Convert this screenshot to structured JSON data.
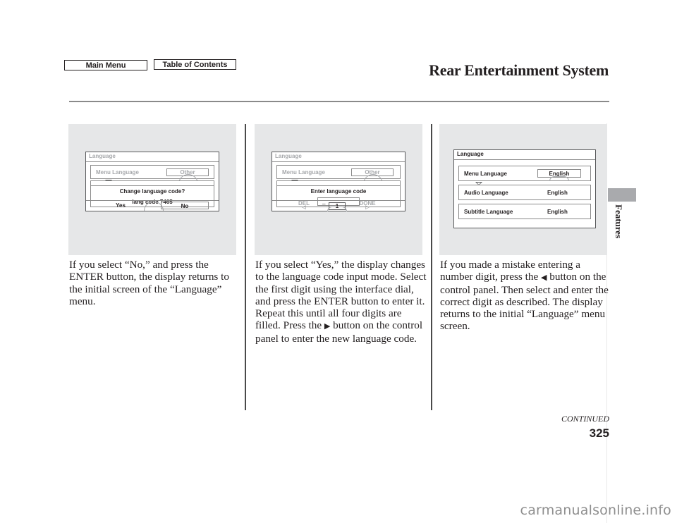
{
  "nav": {
    "main_menu": "Main Menu",
    "table_of_contents": "Table of Contents"
  },
  "header": {
    "section_title": "Rear Entertainment System",
    "side_tab": "Features"
  },
  "screens": [
    {
      "title": "Language",
      "row_label": "Menu Language",
      "row_value": "Other",
      "dialog_line1": "Change language code?",
      "dialog_line2": "lang code 7465",
      "buttons": [
        "Yes",
        "No"
      ]
    },
    {
      "title": "Language",
      "row_label": "Menu Language",
      "row_value": "Other",
      "dialog_line1": "Enter language code",
      "input_value": "_",
      "buttons": [
        "DEL",
        "1",
        "DONE"
      ],
      "icons": [
        "left-arrow-icon",
        "right-arrow-icon"
      ]
    },
    {
      "title": "Language",
      "rows": [
        {
          "label": "Menu Language",
          "value": "English"
        },
        {
          "label": "Audio Language",
          "value": "English"
        },
        {
          "label": "Subtitle Language",
          "value": "English"
        }
      ]
    }
  ],
  "paragraphs": {
    "p1": "If you select “No,” and press the ENTER button, the display returns to the initial screen of the “Language” menu.",
    "p2_before": "If you select “Yes,” the display changes to the language code input mode. Select the first digit using the interface dial, and press the ENTER button to enter it. Repeat this until all four digits are filled. Press the",
    "p2_glyph": "▶",
    "p2_after": "button on the control panel to enter the new language code.",
    "p3_before": "If you made a mistake entering a number digit, press the",
    "p3_glyph": "◀",
    "p3_after": "button on the control panel. Then select and enter the correct digit as described. The display returns to the initial “Language” menu screen."
  },
  "footer": {
    "continued": "CONTINUED",
    "page_number": "325",
    "watermark": "carmanualsonline.info"
  }
}
